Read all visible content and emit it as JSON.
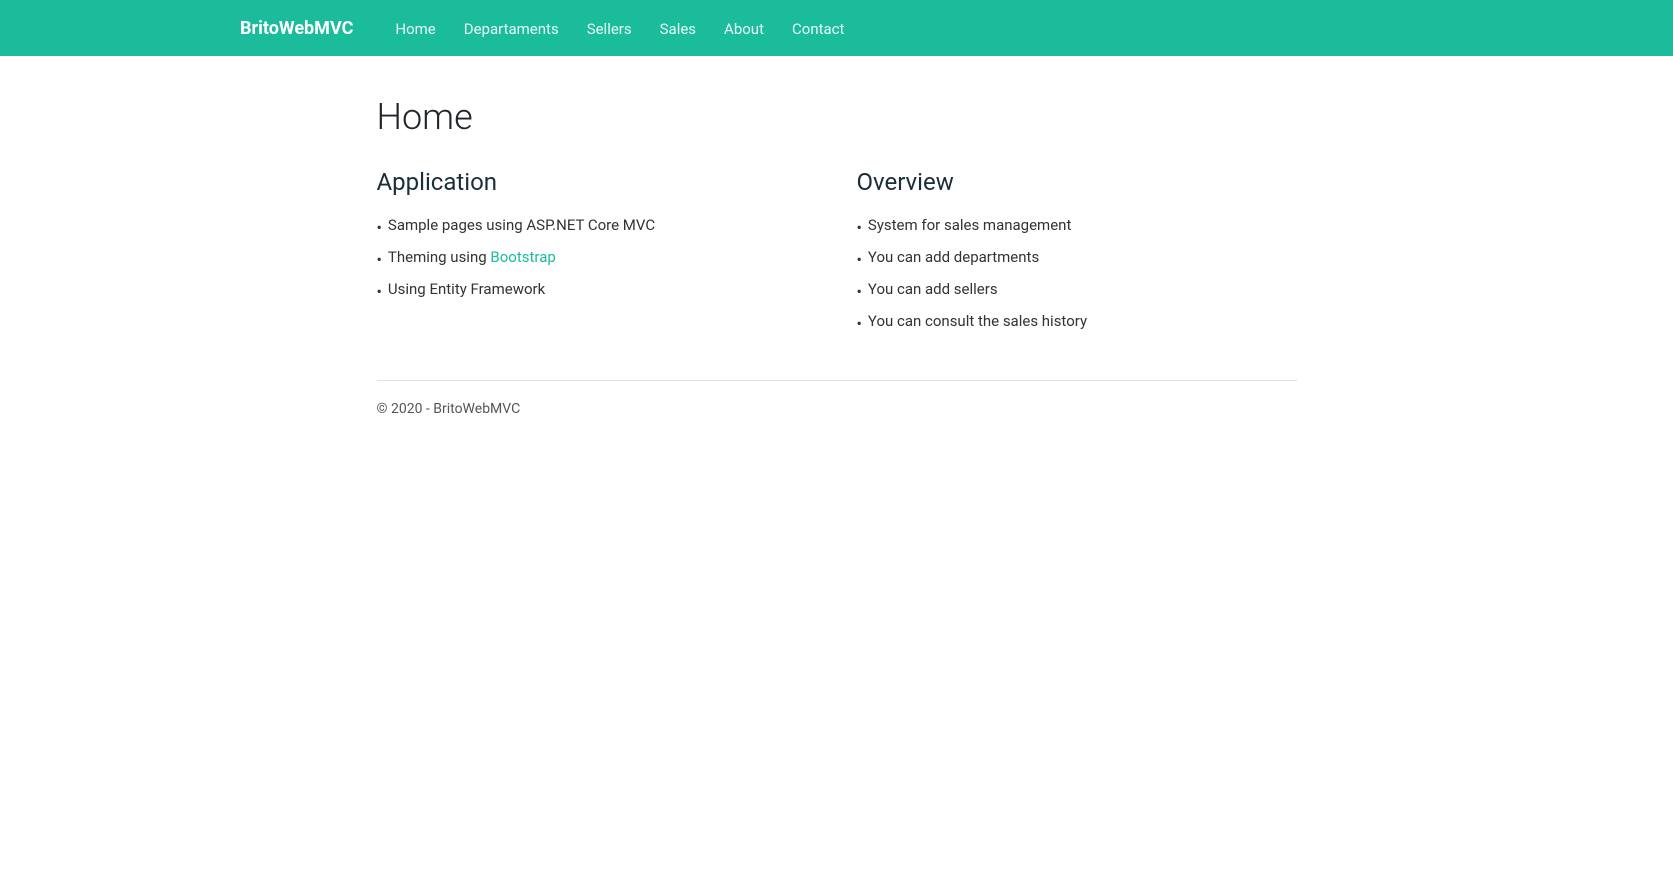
{
  "navbar": {
    "brand": "BritoWebMVC",
    "links": [
      {
        "label": "Home",
        "href": "#"
      },
      {
        "label": "Departaments",
        "href": "#"
      },
      {
        "label": "Sellers",
        "href": "#"
      },
      {
        "label": "Sales",
        "href": "#"
      },
      {
        "label": "About",
        "href": "#"
      },
      {
        "label": "Contact",
        "href": "#"
      }
    ]
  },
  "page": {
    "title": "Home",
    "application": {
      "heading": "Application",
      "items": [
        {
          "text": "Sample pages using ASP.NET Core MVC",
          "link": null
        },
        {
          "text_before": "Theming using ",
          "link_text": "Bootstrap",
          "text_after": "",
          "has_link": true
        },
        {
          "text": "Using Entity Framework",
          "link": null
        }
      ]
    },
    "overview": {
      "heading": "Overview",
      "items": [
        "System for sales management",
        "You can add departments",
        "You can add sellers",
        "You can consult the sales history"
      ]
    },
    "footer": "© 2020 - BritoWebMVC"
  }
}
